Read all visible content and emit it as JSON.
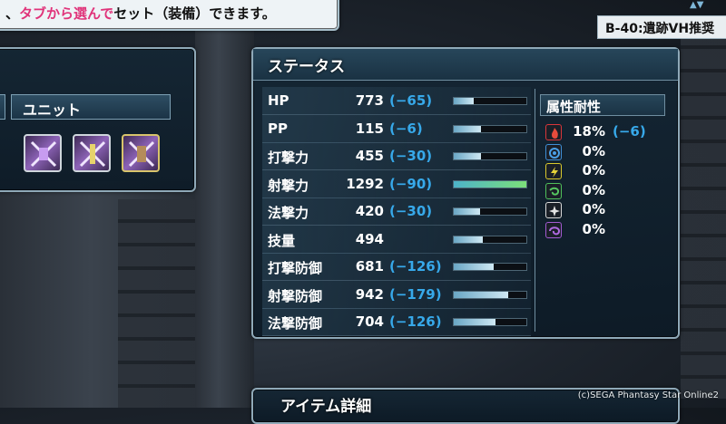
{
  "hint": {
    "prefix": "、",
    "highlight": "タブから選んで",
    "suffix": "セット（装備）できます。"
  },
  "quest": {
    "label": "B-40:遺跡VH推奨"
  },
  "unit_panel": {
    "tab_label": "ユニット",
    "slots": [
      {
        "name": "unit-slot-1",
        "selected": false
      },
      {
        "name": "unit-slot-2",
        "selected": false
      },
      {
        "name": "unit-slot-3",
        "selected": true
      }
    ]
  },
  "status": {
    "title": "ステータス",
    "rows": [
      {
        "name": "HP",
        "value": "773",
        "diff": "(−65)",
        "fill": 0.28
      },
      {
        "name": "PP",
        "value": "115",
        "diff": "(−6)",
        "fill": 0.38
      },
      {
        "name": "打撃力",
        "value": "455",
        "diff": "(−30)",
        "fill": 0.38
      },
      {
        "name": "射撃力",
        "value": "1292",
        "diff": "(−90)",
        "fill": 1.0,
        "accent": true
      },
      {
        "name": "法撃力",
        "value": "420",
        "diff": "(−30)",
        "fill": 0.36
      },
      {
        "name": "技量",
        "value": "494",
        "diff": "",
        "fill": 0.4
      },
      {
        "name": "打撃防御",
        "value": "681",
        "diff": "(−126)",
        "fill": 0.55
      },
      {
        "name": "射撃防御",
        "value": "942",
        "diff": "(−179)",
        "fill": 0.75
      },
      {
        "name": "法撃防御",
        "value": "704",
        "diff": "(−126)",
        "fill": 0.57
      }
    ]
  },
  "resistance": {
    "title": "属性耐性",
    "rows": [
      {
        "icon": "fire-icon",
        "value": "18%",
        "diff": "(−6)",
        "color": "#d9363a"
      },
      {
        "icon": "ice-icon",
        "value": "0%",
        "diff": "",
        "color": "#3f8fd6"
      },
      {
        "icon": "lightning-icon",
        "value": "0%",
        "diff": "",
        "color": "#d9c92c"
      },
      {
        "icon": "wind-icon",
        "value": "0%",
        "diff": "",
        "color": "#4fbf5a"
      },
      {
        "icon": "light-icon",
        "value": "0%",
        "diff": "",
        "color": "#d9d9d9"
      },
      {
        "icon": "dark-icon",
        "value": "0%",
        "diff": "",
        "color": "#a35bd1"
      }
    ]
  },
  "item_panel": {
    "title": "アイテム詳細"
  },
  "copyright": "(c)SEGA Phantasy Star Online2",
  "colors": {
    "diff": "#37a9ea",
    "accent_bar": "#7ce07a"
  }
}
